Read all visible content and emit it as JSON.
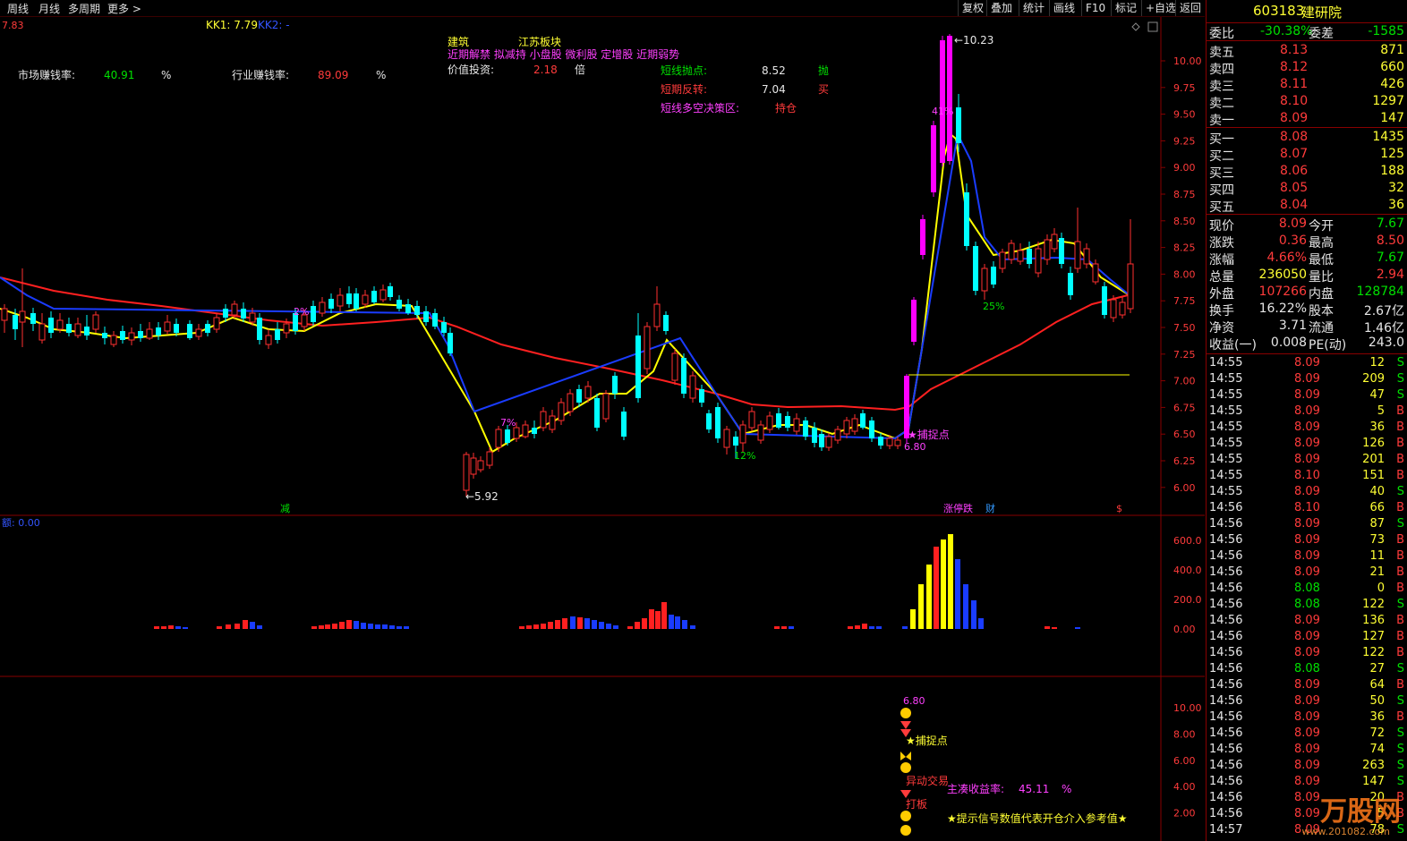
{
  "toolbar": {
    "left": [
      "周线",
      "月线",
      "多周期",
      "更多 >"
    ],
    "right": [
      "复权",
      "叠加",
      "统计",
      "画线",
      "F10",
      "标记",
      "+自选",
      "返回"
    ]
  },
  "chart": {
    "top_left_price": "7.83",
    "kk1_label": "KK1: 7.79",
    "kk2_label": "KK2: -",
    "sector": "建筑",
    "region": "江苏板块",
    "tags": "近期解禁 拟减持 小盘股 微利股 定增股 近期弱势",
    "market_rate_label": "市场赚钱率:",
    "market_rate_value": "40.91",
    "industry_rate_label": "行业赚钱率:",
    "industry_rate_value": "89.09",
    "pct": "%",
    "value_inv_label": "价值投资:",
    "value_inv_value": "2.18",
    "value_inv_unit": "倍",
    "short_sell_label": "短线抛点:",
    "short_sell_value": "8.52",
    "short_sell_flag": "抛",
    "short_rev_label": "短期反转:",
    "short_rev_value": "7.04",
    "short_rev_flag": "买",
    "decision_label": "短线多空决策区:",
    "decision_value": "持仓",
    "high_marker": "←10.23",
    "low_marker": "←5.92",
    "capture_label": "★捕捉点",
    "capture_price": "6.80",
    "pct_marks": [
      "2%",
      "7%",
      "12%",
      "41%",
      "25%"
    ],
    "bottom_marks": [
      "减",
      "涨停跌",
      "财",
      "$"
    ],
    "y_axis": [
      "10.00",
      "9.75",
      "9.50",
      "9.25",
      "9.00",
      "8.75",
      "8.50",
      "8.25",
      "8.00",
      "7.75",
      "7.50",
      "7.25",
      "7.00",
      "6.75",
      "6.50",
      "6.25",
      "6.00"
    ],
    "colors": {
      "ma_red": "#ff2020",
      "ma_yellow": "#ffff00",
      "ma_blue": "#1a3cff",
      "up": "#ff3030",
      "down": "#00ffff",
      "limit": "#ff00ff"
    }
  },
  "volume_panel": {
    "label": "额: 0.00",
    "y_axis": [
      "600.0",
      "400.0",
      "200.0",
      "0.00"
    ]
  },
  "signal_panel": {
    "price": "6.80",
    "capture": "★捕捉点",
    "abnormal": "异动交易",
    "board": "打板",
    "main_label": "主凑收益率:",
    "main_value": "45.11",
    "main_unit": "%",
    "hint": "★提示信号数值代表开仓介入参考值★",
    "y_axis": [
      "10.00",
      "8.00",
      "6.00",
      "4.00",
      "2.00"
    ]
  },
  "quote": {
    "code": "603183",
    "name": "建研院",
    "weibi_label": "委比",
    "weibi_value": "-30.38%",
    "weicha_label": "委差",
    "weicha_value": "-1585",
    "asks": [
      {
        "label": "卖五",
        "price": "8.13",
        "vol": "871"
      },
      {
        "label": "卖四",
        "price": "8.12",
        "vol": "660"
      },
      {
        "label": "卖三",
        "price": "8.11",
        "vol": "426"
      },
      {
        "label": "卖二",
        "price": "8.10",
        "vol": "1297"
      },
      {
        "label": "卖一",
        "price": "8.09",
        "vol": "147"
      }
    ],
    "bids": [
      {
        "label": "买一",
        "price": "8.08",
        "vol": "1435"
      },
      {
        "label": "买二",
        "price": "8.07",
        "vol": "125"
      },
      {
        "label": "买三",
        "price": "8.06",
        "vol": "188"
      },
      {
        "label": "买四",
        "price": "8.05",
        "vol": "32"
      },
      {
        "label": "买五",
        "price": "8.04",
        "vol": "36"
      }
    ],
    "stats": [
      {
        "l1": "现价",
        "v1": "8.09",
        "c1": "red",
        "l2": "今开",
        "v2": "7.67",
        "c2": "grn"
      },
      {
        "l1": "涨跌",
        "v1": "0.36",
        "c1": "red",
        "l2": "最高",
        "v2": "8.50",
        "c2": "red"
      },
      {
        "l1": "涨幅",
        "v1": "4.66%",
        "c1": "red",
        "l2": "最低",
        "v2": "7.67",
        "c2": "grn"
      },
      {
        "l1": "总量",
        "v1": "236050",
        "c1": "yel",
        "l2": "量比",
        "v2": "2.94",
        "c2": "red"
      },
      {
        "l1": "外盘",
        "v1": "107266",
        "c1": "red",
        "l2": "内盘",
        "v2": "128784",
        "c2": "grn"
      },
      {
        "l1": "换手",
        "v1": "16.22%",
        "c1": "wht",
        "l2": "股本",
        "v2": "2.67亿",
        "c2": "wht"
      },
      {
        "l1": "净资",
        "v1": "3.71",
        "c1": "wht",
        "l2": "流通",
        "v2": "1.46亿",
        "c2": "wht"
      },
      {
        "l1": "收益(一)",
        "v1": "0.008",
        "c1": "wht",
        "l2": "PE(动)",
        "v2": "243.0",
        "c2": "wht"
      }
    ],
    "ticks": [
      [
        "14:55",
        "8.09",
        "12",
        "S"
      ],
      [
        "14:55",
        "8.09",
        "209",
        "S"
      ],
      [
        "14:55",
        "8.09",
        "47",
        "S"
      ],
      [
        "14:55",
        "8.09",
        "5",
        "B"
      ],
      [
        "14:55",
        "8.09",
        "36",
        "B"
      ],
      [
        "14:55",
        "8.09",
        "126",
        "B"
      ],
      [
        "14:55",
        "8.09",
        "201",
        "B"
      ],
      [
        "14:55",
        "8.10",
        "151",
        "B"
      ],
      [
        "14:55",
        "8.09",
        "40",
        "S"
      ],
      [
        "14:56",
        "8.10",
        "66",
        "B"
      ],
      [
        "14:56",
        "8.09",
        "87",
        "S"
      ],
      [
        "14:56",
        "8.09",
        "73",
        "B"
      ],
      [
        "14:56",
        "8.09",
        "11",
        "B"
      ],
      [
        "14:56",
        "8.09",
        "21",
        "B"
      ],
      [
        "14:56",
        "8.08",
        "0",
        "B"
      ],
      [
        "14:56",
        "8.08",
        "122",
        "S"
      ],
      [
        "14:56",
        "8.09",
        "136",
        "B"
      ],
      [
        "14:56",
        "8.09",
        "127",
        "B"
      ],
      [
        "14:56",
        "8.09",
        "122",
        "B"
      ],
      [
        "14:56",
        "8.08",
        "27",
        "S"
      ],
      [
        "14:56",
        "8.09",
        "64",
        "B"
      ],
      [
        "14:56",
        "8.09",
        "50",
        "S"
      ],
      [
        "14:56",
        "8.09",
        "36",
        "B"
      ],
      [
        "14:56",
        "8.09",
        "72",
        "S"
      ],
      [
        "14:56",
        "8.09",
        "74",
        "S"
      ],
      [
        "14:56",
        "8.09",
        "263",
        "S"
      ],
      [
        "14:56",
        "8.09",
        "147",
        "S"
      ],
      [
        "14:56",
        "8.09",
        "20",
        "B"
      ],
      [
        "14:56",
        "8.09",
        "5",
        "B"
      ],
      [
        "14:57",
        "8.09",
        "78",
        "S"
      ]
    ],
    "watermark": "万股网",
    "watermark_url": "www.201082.com"
  }
}
